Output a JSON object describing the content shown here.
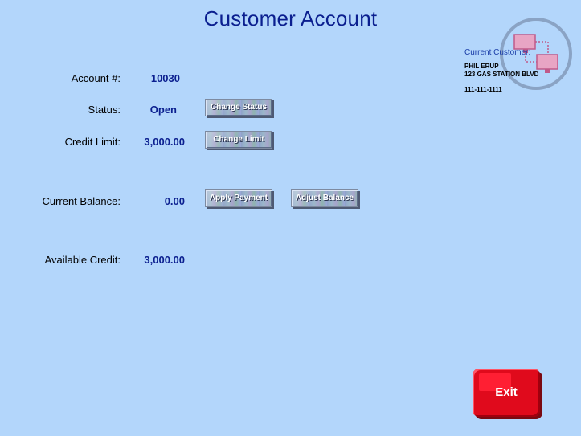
{
  "page": {
    "title": "Customer Account"
  },
  "fields": {
    "account_label": "Account #:",
    "account_value": "10030",
    "status_label": "Status:",
    "status_value": "Open",
    "credit_limit_label": "Credit Limit:",
    "credit_limit_value": "3,000.00",
    "current_balance_label": "Current Balance:",
    "current_balance_value": "0.00",
    "available_credit_label": "Available Credit:",
    "available_credit_value": "3,000.00"
  },
  "buttons": {
    "change_status": "Change Status",
    "change_limit": "Change Limit",
    "apply_payment": "Apply Payment",
    "adjust_balance": "Adjust Balance",
    "exit": "Exit"
  },
  "customer": {
    "caption": "Current Customer:",
    "name": "PHIL ERUP",
    "address": "123 GAS STATION BLVD",
    "phone": "111-111-1111",
    "icon": "network-computers-icon"
  },
  "colors": {
    "background": "#b3d6fb",
    "title": "#0b1f8f",
    "value": "#0b1f8f",
    "exit_button": "#e00a1c"
  }
}
